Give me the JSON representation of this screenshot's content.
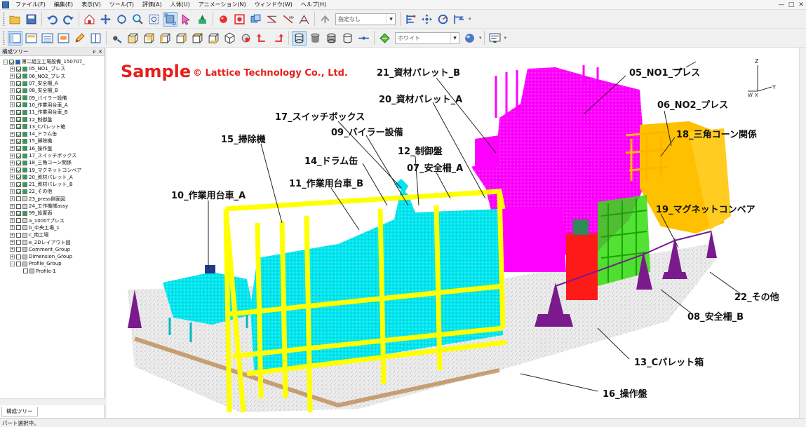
{
  "menu": [
    "ファイル(F)",
    "編集(E)",
    "表示(V)",
    "ツール(T)",
    "評価(A)",
    "人体(U)",
    "アニメーション(N)",
    "ウィンドウ(W)",
    "ヘルプ(H)"
  ],
  "window_controls": [
    "—",
    "□",
    "✕"
  ],
  "toolbar1": {
    "combo_value": "指定なし",
    "icons": [
      "open-icon",
      "save-icon",
      "undo-icon",
      "redo-icon",
      "home-view-icon",
      "pan-icon",
      "rotate-icon",
      "zoom-icon",
      "zoom-box-icon",
      "fit-icon",
      "select-icon",
      "clear-icon",
      "pick-icon",
      "red-point-icon",
      "red-box-icon",
      "measure-icon",
      "distance-icon",
      "angle-icon",
      "annotation-icon",
      "redline-icon",
      "section-icon",
      "move-icon",
      "circle-icon",
      "animation-icon"
    ]
  },
  "toolbar2": {
    "combo_value": "ホワイト",
    "icons": [
      "tree-panel-icon",
      "property-panel-icon",
      "list-panel-icon",
      "dialog-icon",
      "pencil-icon",
      "notes-icon",
      "settings-icon",
      "view-front-icon",
      "view-back-icon",
      "view-left-icon",
      "view-right-icon",
      "view-top-icon",
      "view-bottom-icon",
      "view-iso-icon",
      "shading-icon",
      "rotate-left-icon",
      "rotate-right-icon",
      "cylinder-wire-icon",
      "cylinder-shaded-icon",
      "cylinder-edge-icon",
      "cylinder-hidden-icon",
      "line-icon",
      "background-color-icon",
      "light-icon",
      "display-icon"
    ]
  },
  "tree": {
    "title": "構成ツリー",
    "header_buttons": [
      "ᴘ",
      "✕"
    ],
    "tab_label": "構成ツリー",
    "items": [
      {
        "label": "第二組立工場設備_150707_",
        "level": 0,
        "checked": true,
        "node": "root"
      },
      {
        "label": "05_NO1_プレス",
        "level": 1,
        "checked": true,
        "node": "part"
      },
      {
        "label": "06_NO2_プレス",
        "level": 1,
        "checked": true,
        "node": "part"
      },
      {
        "label": "07_安全柵_A",
        "level": 1,
        "checked": true,
        "node": "part"
      },
      {
        "label": "08_安全柵_B",
        "level": 1,
        "checked": true,
        "node": "part"
      },
      {
        "label": "09_バイラー設備",
        "level": 1,
        "checked": true,
        "node": "part"
      },
      {
        "label": "10_作業用台車_A",
        "level": 1,
        "checked": true,
        "node": "part"
      },
      {
        "label": "11_作業用台車_B",
        "level": 1,
        "checked": true,
        "node": "part"
      },
      {
        "label": "12_制御盤",
        "level": 1,
        "checked": true,
        "node": "part"
      },
      {
        "label": "13_Cパレット箱",
        "level": 1,
        "checked": true,
        "node": "part"
      },
      {
        "label": "14_ドラム缶",
        "level": 1,
        "checked": true,
        "node": "part"
      },
      {
        "label": "15_掃除機",
        "level": 1,
        "checked": true,
        "node": "part"
      },
      {
        "label": "16_操作盤",
        "level": 1,
        "checked": true,
        "node": "part"
      },
      {
        "label": "17_スイッチボックス",
        "level": 1,
        "checked": true,
        "node": "part"
      },
      {
        "label": "18_三角コーン関係",
        "level": 1,
        "checked": true,
        "node": "part"
      },
      {
        "label": "19_マグネットコンベア",
        "level": 1,
        "checked": true,
        "node": "part"
      },
      {
        "label": "20_資材パレット_A",
        "level": 1,
        "checked": true,
        "node": "part"
      },
      {
        "label": "21_資材パレット_B",
        "level": 1,
        "checked": true,
        "node": "part"
      },
      {
        "label": "22_その他",
        "level": 1,
        "checked": true,
        "node": "part"
      },
      {
        "label": "23_press側面図",
        "level": 1,
        "checked": false,
        "node": "drawing"
      },
      {
        "label": "24_工作機械assy",
        "level": 1,
        "checked": false,
        "node": "drawing"
      },
      {
        "label": "99_設置面",
        "level": 1,
        "checked": true,
        "node": "part"
      },
      {
        "label": "a_1000Tプレス",
        "level": 1,
        "checked": false,
        "node": "drawing"
      },
      {
        "label": "b_中央工場_1",
        "level": 1,
        "checked": false,
        "node": "drawing"
      },
      {
        "label": "c_南工場",
        "level": 1,
        "checked": false,
        "node": "drawing"
      },
      {
        "label": "e_2Dレイアウト図",
        "level": 1,
        "checked": false,
        "node": "drawing"
      },
      {
        "label": "Comment_Group",
        "level": 1,
        "checked": false,
        "node": "comment"
      },
      {
        "label": "Dimension_Group",
        "level": 1,
        "checked": false,
        "node": "dimension"
      },
      {
        "label": "Profile_Group",
        "level": 1,
        "checked": false,
        "node": "profile",
        "expanded": true
      },
      {
        "label": "Profile-1",
        "level": 2,
        "checked": false,
        "node": "profile-item"
      }
    ]
  },
  "viewport": {
    "watermark_main": "Sample",
    "watermark_copyright": "© Lattice Technology Co., Ltd.",
    "axis_labels": {
      "z": "Z",
      "y": "Y",
      "x": "X",
      "w": "W"
    },
    "callouts": [
      "21_資材パレット_B",
      "05_NO1_プレス",
      "20_資材パレット_A",
      "06_NO2_プレス",
      "17_スイッチボックス",
      "09_バイラー設備",
      "18_三角コーン関係",
      "15_掃除機",
      "12_制御盤",
      "14_ドラム缶",
      "07_安全柵_A",
      "11_作業用台車_B",
      "10_作業用台車_A",
      "19_マグネットコンベア",
      "22_その他",
      "08_安全柵_B",
      "13_Cパレット箱",
      "16_操作盤"
    ],
    "colors": {
      "fence_yellow": "#ffff00",
      "press_magenta": "#ff00ff",
      "equipment_cyan": "#00e5ee",
      "cone_purple": "#7a1a8c",
      "panel_red": "#ff1a1a",
      "conveyor_green": "#33dd11",
      "orange_fence": "#ffb300",
      "watermark_red": "#e5201b"
    }
  },
  "status": {
    "text": "パート選択中。"
  }
}
